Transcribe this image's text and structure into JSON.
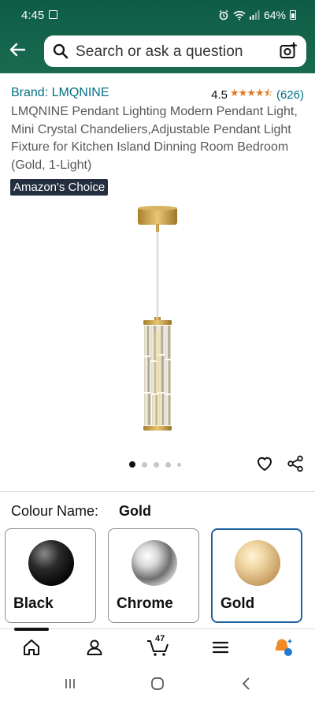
{
  "status_bar": {
    "time": "4:45",
    "battery": "64%"
  },
  "search": {
    "placeholder": "Search or ask a question"
  },
  "product": {
    "brand": "Brand: LMQNINE",
    "rating": "4.5",
    "stars": "★★★★⯪",
    "rating_count": "(626)",
    "title": "LMQNINE Pendant Lighting Modern Pendant Light, Mini Crystal Chandeliers,Adjustable Pendant Light Fixture for Kitchen Island Dinning Room Bedroom (Gold, 1-Light)",
    "badge": "Amazon's Choice",
    "image_count": 5,
    "active_image": 1
  },
  "colour": {
    "label": "Colour Name:",
    "selected": "Gold",
    "options": [
      {
        "name": "Black"
      },
      {
        "name": "Chrome"
      },
      {
        "name": "Gold"
      }
    ]
  },
  "bottom_nav": {
    "cart_count": "47",
    "items": [
      "home-icon",
      "account-icon",
      "cart-icon",
      "menu-icon",
      "assistant-icon"
    ]
  },
  "colors": {
    "header_green": "#14654c",
    "link_blue": "#007185",
    "star_orange": "#de7921",
    "selected_border": "#2162a1"
  }
}
